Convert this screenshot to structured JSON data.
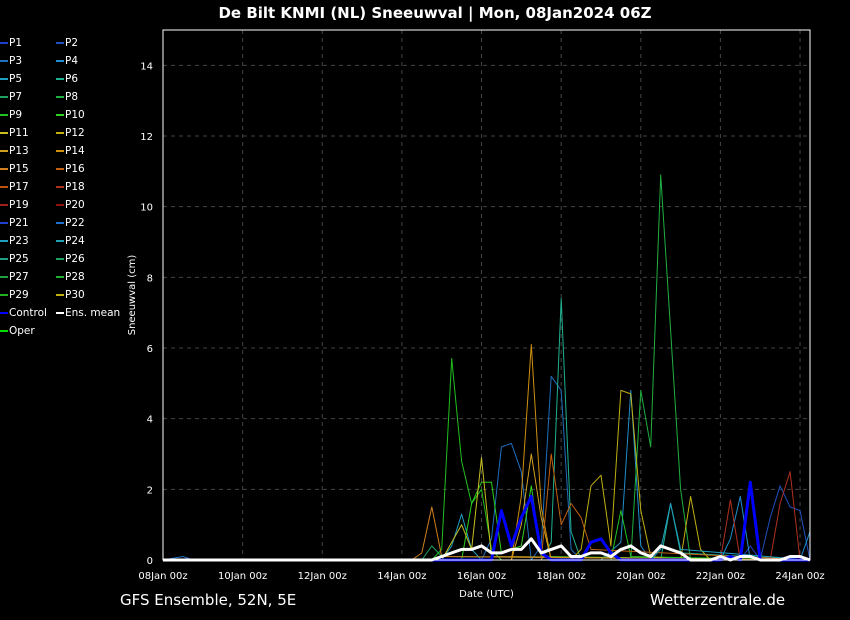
{
  "chart_data": {
    "type": "line",
    "title": "De Bilt KNMI  (NL)  Sneeuwval | Mon, 08Jan2024 06Z",
    "xlabel": "Date (UTC)",
    "ylabel": "Sneeuwval (cm)",
    "x_unit": "days since 08Jan 00z",
    "xlim": [
      0,
      16.25
    ],
    "ylim": [
      0,
      15
    ],
    "xticks": [
      {
        "v": 0,
        "label": "08Jan 00z"
      },
      {
        "v": 2,
        "label": "10Jan 00z"
      },
      {
        "v": 4,
        "label": "12Jan 00z"
      },
      {
        "v": 6,
        "label": "14Jan 00z"
      },
      {
        "v": 8,
        "label": "16Jan 00z"
      },
      {
        "v": 10,
        "label": "18Jan 00z"
      },
      {
        "v": 12,
        "label": "20Jan 00z"
      },
      {
        "v": 14,
        "label": "22Jan 00z"
      },
      {
        "v": 16,
        "label": "24Jan 00z"
      }
    ],
    "yticks": [
      0,
      2,
      4,
      6,
      8,
      10,
      12,
      14
    ],
    "grid": true,
    "legend_placement": "left-outside",
    "series": [
      {
        "name": "P1",
        "color": "#1f3fcf",
        "points": [
          [
            0,
            0
          ],
          [
            14.5,
            0
          ],
          [
            14.75,
            0.4
          ],
          [
            15,
            0
          ],
          [
            16.25,
            0
          ]
        ]
      },
      {
        "name": "P2",
        "color": "#1f4fbf",
        "points": [
          [
            0,
            0
          ],
          [
            15,
            0
          ],
          [
            15.25,
            1.2
          ],
          [
            15.5,
            2.1
          ],
          [
            15.75,
            1.5
          ],
          [
            16,
            1.4
          ],
          [
            16.25,
            0
          ]
        ]
      },
      {
        "name": "P3",
        "color": "#1f6fbf",
        "points": [
          [
            0,
            0
          ],
          [
            0.5,
            0.1
          ],
          [
            0.75,
            0
          ],
          [
            8,
            0
          ],
          [
            8.25,
            0.6
          ],
          [
            8.5,
            3.2
          ],
          [
            8.75,
            3.3
          ],
          [
            9,
            2.5
          ],
          [
            9.25,
            0
          ],
          [
            9.5,
            0.4
          ],
          [
            9.75,
            5.2
          ],
          [
            10,
            4.8
          ],
          [
            10.25,
            0.3
          ],
          [
            10.5,
            0
          ],
          [
            16.25,
            0
          ]
        ]
      },
      {
        "name": "P4",
        "color": "#1f8fcf",
        "points": [
          [
            0,
            0
          ],
          [
            11,
            0
          ],
          [
            11.5,
            0.5
          ],
          [
            11.75,
            4.8
          ],
          [
            12,
            0.4
          ],
          [
            12.25,
            0
          ],
          [
            14,
            0
          ],
          [
            14.25,
            0.6
          ],
          [
            14.5,
            1.8
          ],
          [
            14.75,
            0
          ],
          [
            16,
            0
          ],
          [
            16.25,
            0.8
          ],
          [
            16.25,
            0
          ]
        ]
      },
      {
        "name": "P5",
        "color": "#1fa0c0",
        "points": [
          [
            0,
            0
          ],
          [
            7,
            0
          ],
          [
            7.25,
            0.4
          ],
          [
            7.5,
            1.3
          ],
          [
            7.75,
            0.3
          ],
          [
            8,
            0
          ],
          [
            16.25,
            0
          ]
        ]
      },
      {
        "name": "P6",
        "color": "#1fb090",
        "points": [
          [
            0,
            0
          ],
          [
            9.5,
            0
          ],
          [
            9.75,
            0.5
          ],
          [
            10,
            7.4
          ],
          [
            10.25,
            0.8
          ],
          [
            10.5,
            0
          ],
          [
            12.5,
            0
          ],
          [
            12.75,
            1.6
          ],
          [
            13,
            0.2
          ],
          [
            16.25,
            0
          ]
        ]
      },
      {
        "name": "P7",
        "color": "#1fa060",
        "points": [
          [
            0,
            0
          ],
          [
            6.5,
            0
          ],
          [
            6.75,
            0.4
          ],
          [
            7,
            0.1
          ],
          [
            16.25,
            0
          ]
        ]
      },
      {
        "name": "P8",
        "color": "#20b040",
        "points": [
          [
            0,
            0
          ],
          [
            11.75,
            0
          ],
          [
            12,
            4.8
          ],
          [
            12.25,
            3.2
          ],
          [
            12.5,
            10.9
          ],
          [
            12.75,
            6.5
          ],
          [
            13,
            2.0
          ],
          [
            13.25,
            0
          ],
          [
            16.25,
            0
          ]
        ]
      },
      {
        "name": "P9",
        "color": "#20c020",
        "points": [
          [
            0,
            0
          ],
          [
            6.75,
            0
          ],
          [
            7,
            0.3
          ],
          [
            7.25,
            5.7
          ],
          [
            7.5,
            2.8
          ],
          [
            7.75,
            1.6
          ],
          [
            8,
            2.0
          ],
          [
            8.25,
            0.3
          ],
          [
            8.5,
            0
          ],
          [
            11.25,
            0
          ],
          [
            11.5,
            1.4
          ],
          [
            11.75,
            0.1
          ],
          [
            16.25,
            0
          ]
        ]
      },
      {
        "name": "P10",
        "color": "#30d020",
        "points": [
          [
            0,
            0
          ],
          [
            7.5,
            0
          ],
          [
            7.75,
            1.6
          ],
          [
            8,
            2.2
          ],
          [
            8.25,
            2.2
          ],
          [
            8.5,
            0.2
          ],
          [
            9,
            0.4
          ],
          [
            9.25,
            2.1
          ],
          [
            9.5,
            0.1
          ],
          [
            16.25,
            0
          ]
        ]
      },
      {
        "name": "P11",
        "color": "#c8c020",
        "points": [
          [
            0,
            0
          ],
          [
            7,
            0
          ],
          [
            7.5,
            1.0
          ],
          [
            7.75,
            0.3
          ],
          [
            8,
            2.9
          ],
          [
            8.25,
            0.1
          ],
          [
            16.25,
            0
          ]
        ]
      },
      {
        "name": "P12",
        "color": "#c0b010",
        "points": [
          [
            0,
            0
          ],
          [
            10.25,
            0
          ],
          [
            10.5,
            0.3
          ],
          [
            10.75,
            2.1
          ],
          [
            11,
            2.4
          ],
          [
            11.25,
            0.4
          ],
          [
            11.5,
            4.8
          ],
          [
            11.75,
            4.7
          ],
          [
            12,
            1.4
          ],
          [
            12.25,
            0.1
          ],
          [
            13,
            0
          ],
          [
            13.25,
            1.8
          ],
          [
            13.5,
            0.3
          ],
          [
            13.75,
            0
          ],
          [
            16.25,
            0
          ]
        ]
      },
      {
        "name": "P13",
        "color": "#d0a020",
        "points": [
          [
            0,
            0
          ],
          [
            8.75,
            0
          ],
          [
            9,
            1.0
          ],
          [
            9.25,
            3.0
          ],
          [
            9.5,
            1.2
          ],
          [
            9.75,
            0
          ],
          [
            16.25,
            0
          ]
        ]
      },
      {
        "name": "P14",
        "color": "#d09010",
        "points": [
          [
            0,
            0
          ],
          [
            8.75,
            0
          ],
          [
            9,
            1.8
          ],
          [
            9.25,
            6.1
          ],
          [
            9.5,
            1.5
          ],
          [
            9.75,
            0
          ],
          [
            16.25,
            0
          ]
        ]
      },
      {
        "name": "P15",
        "color": "#d08020",
        "points": [
          [
            0,
            0
          ],
          [
            6.25,
            0
          ],
          [
            6.5,
            0.2
          ],
          [
            6.75,
            1.5
          ],
          [
            7,
            0.1
          ],
          [
            16.25,
            0
          ]
        ]
      },
      {
        "name": "P16",
        "color": "#c06010",
        "points": [
          [
            0,
            0
          ],
          [
            9.5,
            0
          ],
          [
            9.75,
            3.0
          ],
          [
            10,
            1.0
          ],
          [
            10.25,
            1.6
          ],
          [
            10.5,
            1.2
          ],
          [
            10.75,
            0.3
          ],
          [
            16.25,
            0
          ]
        ]
      },
      {
        "name": "P18",
        "color": "#b03020",
        "points": [
          [
            0,
            0
          ],
          [
            14,
            0
          ],
          [
            14.25,
            1.7
          ],
          [
            14.5,
            0
          ],
          [
            15.25,
            0
          ],
          [
            15.5,
            1.6
          ],
          [
            15.75,
            2.5
          ],
          [
            16,
            0
          ],
          [
            16.25,
            0
          ]
        ]
      },
      {
        "name": "P23",
        "color": "#20a0c0",
        "points": [
          [
            0,
            0
          ],
          [
            12.25,
            0
          ],
          [
            12.5,
            0.3
          ],
          [
            12.75,
            1.6
          ],
          [
            13,
            0.3
          ],
          [
            16.25,
            0
          ]
        ]
      },
      {
        "name": "Control",
        "color": "#0000ff",
        "width": 3,
        "points": [
          [
            0,
            0
          ],
          [
            8.25,
            0
          ],
          [
            8.5,
            1.4
          ],
          [
            8.75,
            0.4
          ],
          [
            9,
            1.2
          ],
          [
            9.25,
            1.8
          ],
          [
            9.5,
            0.2
          ],
          [
            9.75,
            0
          ],
          [
            10.5,
            0
          ],
          [
            10.75,
            0.5
          ],
          [
            11,
            0.6
          ],
          [
            11.25,
            0.2
          ],
          [
            11.5,
            0
          ],
          [
            14,
            0
          ],
          [
            14.25,
            0.1
          ],
          [
            14.5,
            0
          ],
          [
            14.75,
            2.2
          ],
          [
            15,
            0
          ],
          [
            16.25,
            0
          ]
        ]
      },
      {
        "name": "Ens. mean",
        "color": "#ffffff",
        "width": 3,
        "points": [
          [
            0,
            0
          ],
          [
            6.75,
            0
          ],
          [
            7,
            0.1
          ],
          [
            7.25,
            0.2
          ],
          [
            7.5,
            0.3
          ],
          [
            7.75,
            0.3
          ],
          [
            8,
            0.4
          ],
          [
            8.25,
            0.2
          ],
          [
            8.5,
            0.2
          ],
          [
            8.75,
            0.3
          ],
          [
            9,
            0.3
          ],
          [
            9.25,
            0.6
          ],
          [
            9.5,
            0.2
          ],
          [
            9.75,
            0.3
          ],
          [
            10,
            0.4
          ],
          [
            10.25,
            0.1
          ],
          [
            10.5,
            0.1
          ],
          [
            10.75,
            0.2
          ],
          [
            11,
            0.2
          ],
          [
            11.25,
            0.1
          ],
          [
            11.5,
            0.3
          ],
          [
            11.75,
            0.4
          ],
          [
            12,
            0.2
          ],
          [
            12.25,
            0.1
          ],
          [
            12.5,
            0.4
          ],
          [
            12.75,
            0.3
          ],
          [
            13,
            0.2
          ],
          [
            13.25,
            0
          ],
          [
            13.75,
            0
          ],
          [
            14,
            0.1
          ],
          [
            14.25,
            0
          ],
          [
            14.5,
            0.1
          ],
          [
            14.75,
            0.1
          ],
          [
            15,
            0
          ],
          [
            15.5,
            0
          ],
          [
            15.75,
            0.1
          ],
          [
            16,
            0.1
          ],
          [
            16.25,
            0
          ]
        ]
      },
      {
        "name": "Oper",
        "color": "#00e000",
        "points": [
          [
            0,
            0
          ],
          [
            16.25,
            0
          ]
        ]
      }
    ]
  },
  "legend": {
    "items": [
      {
        "label": "P1",
        "color": "#1f3fcf"
      },
      {
        "label": "P2",
        "color": "#1f4fbf"
      },
      {
        "label": "P3",
        "color": "#1f6fbf"
      },
      {
        "label": "P4",
        "color": "#1f8fcf"
      },
      {
        "label": "P5",
        "color": "#1fa0c0"
      },
      {
        "label": "P6",
        "color": "#1fb090"
      },
      {
        "label": "P7",
        "color": "#1fa060"
      },
      {
        "label": "P8",
        "color": "#20b040"
      },
      {
        "label": "P9",
        "color": "#20c020"
      },
      {
        "label": "P10",
        "color": "#30d020"
      },
      {
        "label": "P11",
        "color": "#c8c020"
      },
      {
        "label": "P12",
        "color": "#c0b010"
      },
      {
        "label": "P13",
        "color": "#d0a020"
      },
      {
        "label": "P14",
        "color": "#d09010"
      },
      {
        "label": "P15",
        "color": "#d08020"
      },
      {
        "label": "P16",
        "color": "#c06010"
      },
      {
        "label": "P17",
        "color": "#c05010"
      },
      {
        "label": "P18",
        "color": "#b03020"
      },
      {
        "label": "P19",
        "color": "#a02020"
      },
      {
        "label": "P20",
        "color": "#901010"
      },
      {
        "label": "P21",
        "color": "#1f3fcf"
      },
      {
        "label": "P22",
        "color": "#1f6fcf"
      },
      {
        "label": "P23",
        "color": "#20a0c0"
      },
      {
        "label": "P24",
        "color": "#20a0b0"
      },
      {
        "label": "P25",
        "color": "#20a080"
      },
      {
        "label": "P26",
        "color": "#20a060"
      },
      {
        "label": "P27",
        "color": "#20a040"
      },
      {
        "label": "P28",
        "color": "#20b030"
      },
      {
        "label": "P29",
        "color": "#20b020"
      },
      {
        "label": "P30",
        "color": "#c0b010"
      },
      {
        "label": "Control",
        "color": "#0000ff"
      },
      {
        "label": "Ens. mean",
        "color": "#ffffff"
      },
      {
        "label": "Oper",
        "color": "#00e000"
      }
    ]
  },
  "footer": {
    "left": "GFS Ensemble, 52N, 5E",
    "right": "Wetterzentrale.de"
  }
}
